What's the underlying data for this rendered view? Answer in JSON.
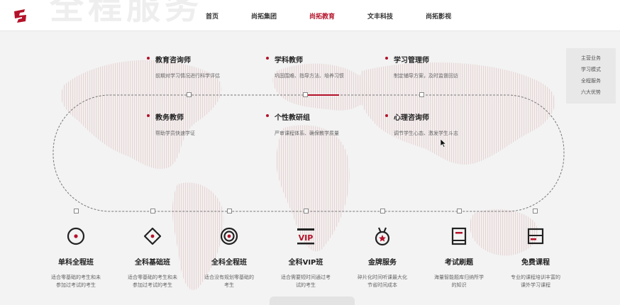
{
  "header": {
    "watermark": "全程服务",
    "nav": [
      {
        "label": "首页",
        "active": false
      },
      {
        "label": "尚拓集团",
        "active": false
      },
      {
        "label": "尚拓教育",
        "active": true
      },
      {
        "label": "文丰科技",
        "active": false
      },
      {
        "label": "尚拓影视",
        "active": false
      }
    ]
  },
  "side_menu": [
    "主营业务",
    "学习模式",
    "全程服务",
    "六大优势"
  ],
  "roles": [
    {
      "title": "教育咨询师",
      "desc": "前期对学习情况进行科学评估"
    },
    {
      "title": "学科教师",
      "desc": "巩固围难、指导方法、培养习惯"
    },
    {
      "title": "学习管理师",
      "desc": "制定辅导方案，及时监督回访"
    },
    {
      "title": "教务教师",
      "desc": "帮助学员快速学证"
    },
    {
      "title": "个性教研组",
      "desc": "严审课程体系、确保教学质量"
    },
    {
      "title": "心理咨询师",
      "desc": "调节学生心态、激发学生斗志"
    }
  ],
  "courses": [
    {
      "icon": "target-dot-icon",
      "title": "单科全程班",
      "desc": "适合零基础的考生和未参加过考试的考生"
    },
    {
      "icon": "direction-arrows-icon",
      "title": "全科基础班",
      "desc": "适合零基础的考生和未参加过考试的考生"
    },
    {
      "icon": "bullseye-icon",
      "title": "全科全程班",
      "desc": "适合没有规划零基础的考生"
    },
    {
      "icon": "vip-icon",
      "title": "全科VIP班",
      "desc": "适合需要短时间通过考试的考生"
    },
    {
      "icon": "medal-icon",
      "title": "金牌服务",
      "desc": "碎片化时间听课最大化节省时间成本"
    },
    {
      "icon": "book-icon",
      "title": "考试刷题",
      "desc": "海量智能题库归纳所学的知识"
    },
    {
      "icon": "window-icon",
      "title": "免费课程",
      "desc": "专业的课程培训丰富的课外学习课程"
    }
  ],
  "colors": {
    "accent": "#b4122a",
    "background": "#f3f3f3"
  }
}
